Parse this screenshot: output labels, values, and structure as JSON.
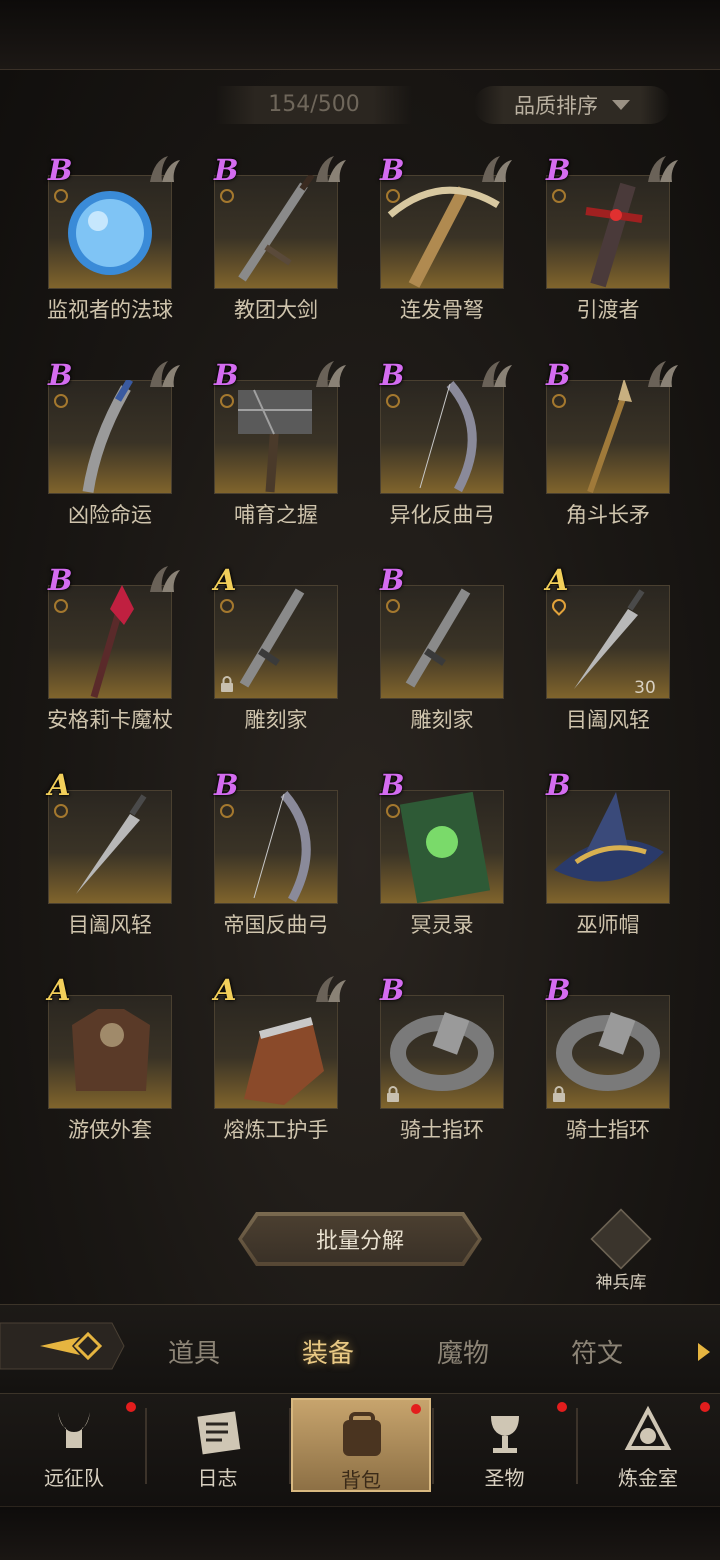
{
  "header": {
    "count": "154/500",
    "sort_label": "品质排序"
  },
  "items": [
    {
      "name": "监视者的法球",
      "grade": "B",
      "horn": true,
      "lock": false,
      "ring": "normal",
      "level": "",
      "art": "orb"
    },
    {
      "name": "教团大剑",
      "grade": "B",
      "horn": true,
      "lock": false,
      "ring": "normal",
      "level": "",
      "art": "sword"
    },
    {
      "name": "连发骨弩",
      "grade": "B",
      "horn": true,
      "lock": false,
      "ring": "normal",
      "level": "",
      "art": "crossbow"
    },
    {
      "name": "引渡者",
      "grade": "B",
      "horn": true,
      "lock": false,
      "ring": "normal",
      "level": "",
      "art": "redsword"
    },
    {
      "name": "凶险命运",
      "grade": "B",
      "horn": true,
      "lock": false,
      "ring": "normal",
      "level": "",
      "art": "dagger"
    },
    {
      "name": "哺育之握",
      "grade": "B",
      "horn": true,
      "lock": false,
      "ring": "normal",
      "level": "",
      "art": "hammer"
    },
    {
      "name": "异化反曲弓",
      "grade": "B",
      "horn": true,
      "lock": false,
      "ring": "normal",
      "level": "",
      "art": "bow"
    },
    {
      "name": "角斗长矛",
      "grade": "B",
      "horn": true,
      "lock": false,
      "ring": "normal",
      "level": "",
      "art": "spear"
    },
    {
      "name": "安格莉卡魔杖",
      "grade": "B",
      "horn": true,
      "lock": false,
      "ring": "normal",
      "level": "",
      "art": "staff"
    },
    {
      "name": "雕刻家",
      "grade": "A",
      "horn": false,
      "lock": true,
      "ring": "normal",
      "level": "",
      "art": "carver"
    },
    {
      "name": "雕刻家",
      "grade": "B",
      "horn": false,
      "lock": false,
      "ring": "normal",
      "level": "",
      "art": "carver"
    },
    {
      "name": "目阖风轻",
      "grade": "A",
      "horn": false,
      "lock": false,
      "ring": "flame",
      "level": "30",
      "art": "knife"
    },
    {
      "name": "目阖风轻",
      "grade": "A",
      "horn": false,
      "lock": false,
      "ring": "normal",
      "level": "",
      "art": "knife"
    },
    {
      "name": "帝国反曲弓",
      "grade": "B",
      "horn": false,
      "lock": false,
      "ring": "normal",
      "level": "",
      "art": "bow"
    },
    {
      "name": "冥灵录",
      "grade": "B",
      "horn": false,
      "lock": false,
      "ring": "normal",
      "level": "",
      "art": "book"
    },
    {
      "name": "巫师帽",
      "grade": "B",
      "horn": false,
      "lock": false,
      "ring": "none",
      "level": "",
      "art": "hat"
    },
    {
      "name": "游侠外套",
      "grade": "A",
      "horn": false,
      "lock": false,
      "ring": "none",
      "level": "",
      "art": "armor"
    },
    {
      "name": "熔炼工护手",
      "grade": "A",
      "horn": true,
      "lock": false,
      "ring": "none",
      "level": "",
      "art": "gauntlet"
    },
    {
      "name": "骑士指环",
      "grade": "B",
      "horn": false,
      "lock": true,
      "ring": "none",
      "level": "",
      "art": "ring"
    },
    {
      "name": "骑士指环",
      "grade": "B",
      "horn": false,
      "lock": true,
      "ring": "none",
      "level": "",
      "art": "ring"
    }
  ],
  "actions": {
    "bulk_label": "批量分解",
    "armory_label": "神兵库"
  },
  "tabs": [
    {
      "label": "道具",
      "active": false
    },
    {
      "label": "装备",
      "active": true
    },
    {
      "label": "魔物",
      "active": false
    },
    {
      "label": "符文",
      "active": false
    }
  ],
  "nav": [
    {
      "label": "远征队",
      "icon": "horned-helmet-icon",
      "badge": true,
      "active": false
    },
    {
      "label": "日志",
      "icon": "scroll-icon",
      "badge": false,
      "active": false
    },
    {
      "label": "背包",
      "icon": "backpack-icon",
      "badge": true,
      "active": true
    },
    {
      "label": "圣物",
      "icon": "chalice-icon",
      "badge": true,
      "active": false
    },
    {
      "label": "炼金室",
      "icon": "alchemy-icon",
      "badge": true,
      "active": false
    }
  ],
  "colors": {
    "grade_b": "#d46cf0",
    "grade_a": "#f2cf5a",
    "tab_active": "#e9c984",
    "badge": "#e31d1d"
  }
}
